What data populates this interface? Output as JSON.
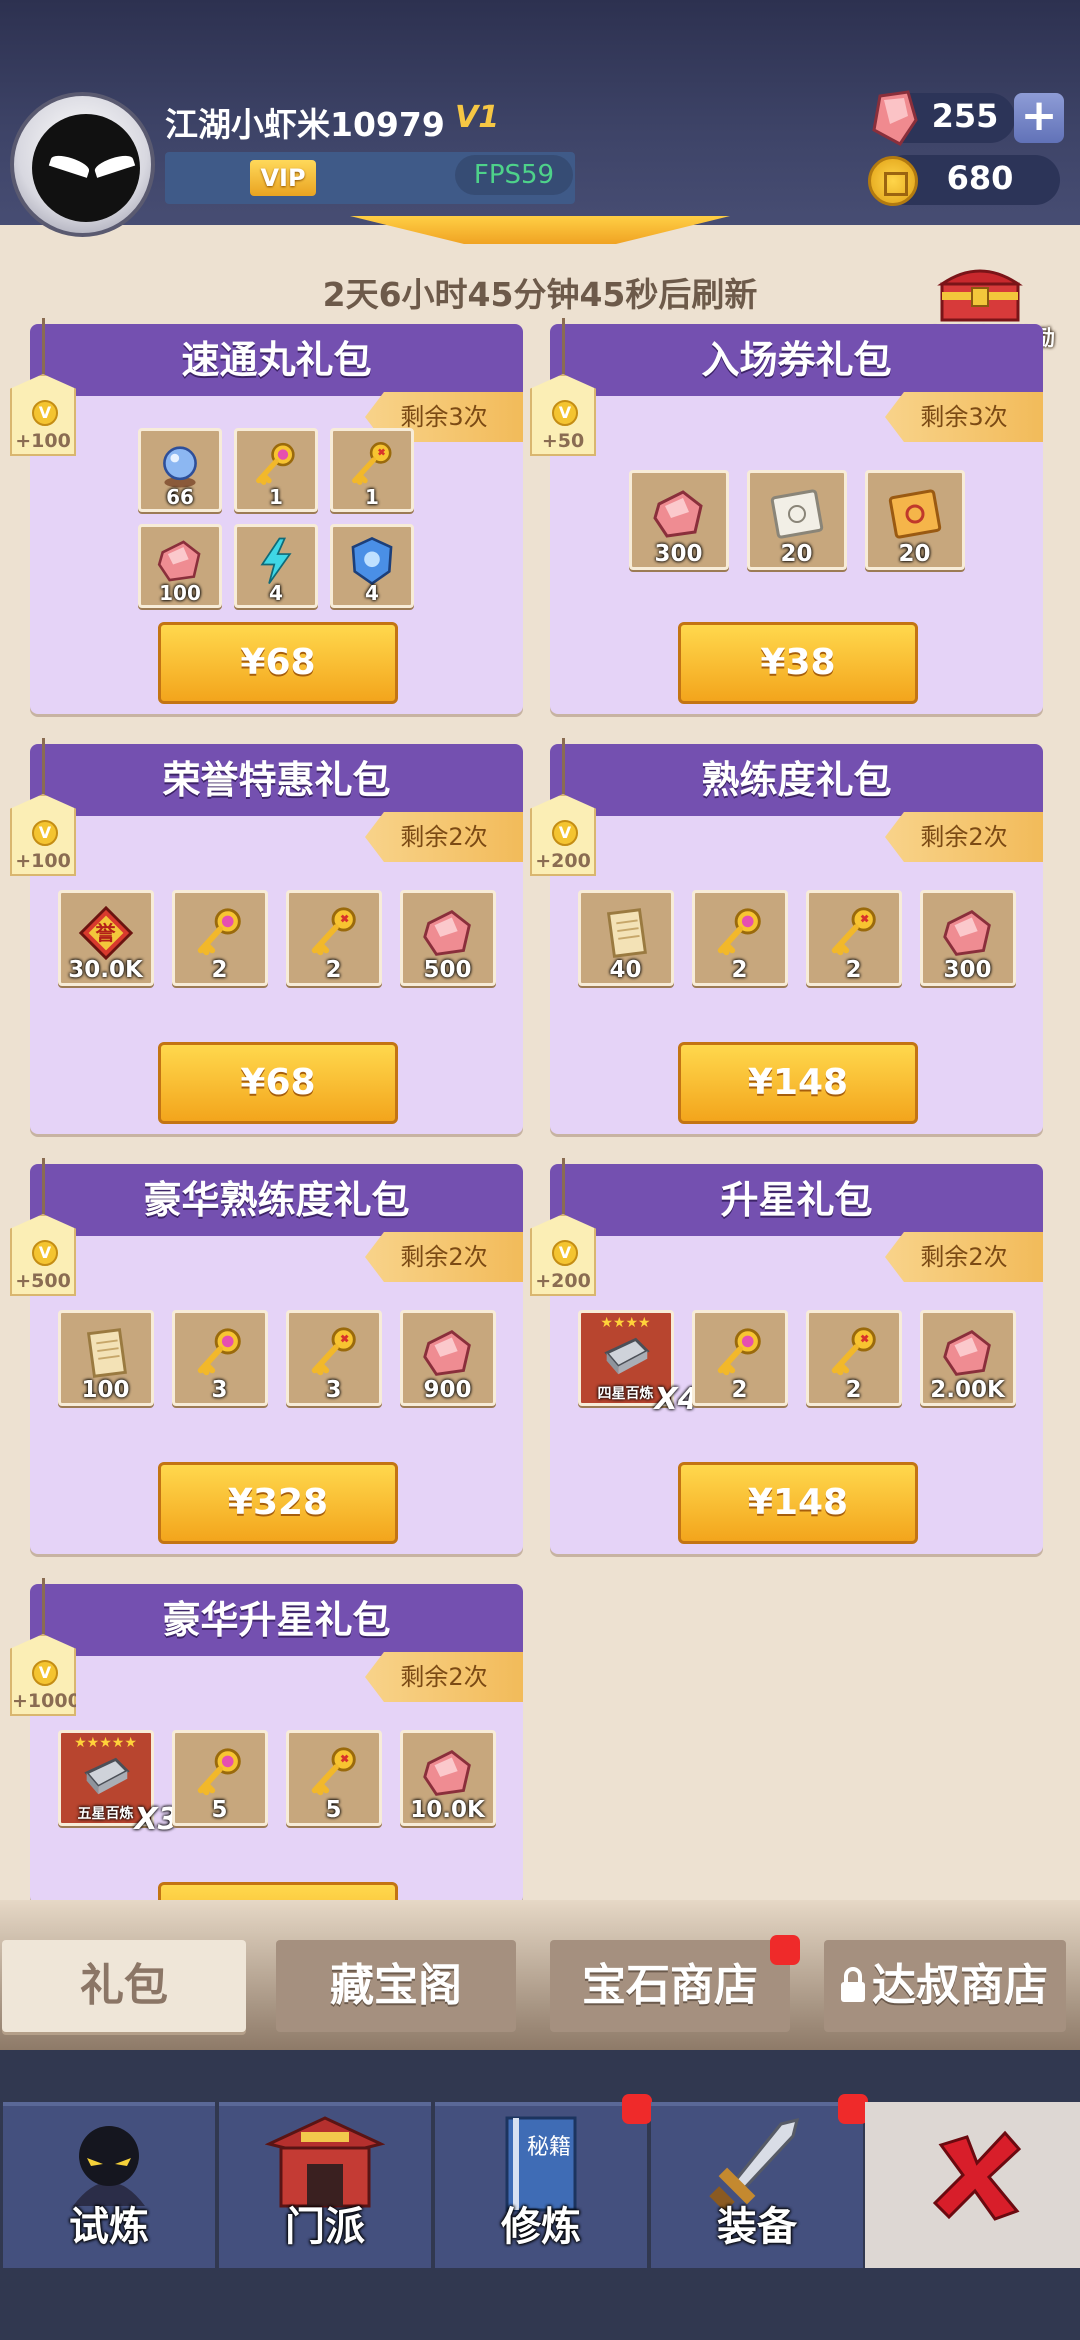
{
  "header": {
    "player_name": "江湖小虾米10979",
    "vip_level": "V1",
    "vip_label": "VIP",
    "fps": "FPS59",
    "gems": "255",
    "coins": "680",
    "add_label": "+"
  },
  "refresh_timer": "2天6小时45分钟45秒后刷新",
  "first_purchase_label": "首次购买奖励",
  "packs": [
    {
      "title": "速通丸礼包",
      "remaining": "剩余3次",
      "vip_points": "+100",
      "price": "¥68",
      "items": [
        {
          "icon": "crystal-ball-icon",
          "count": "66"
        },
        {
          "icon": "pink-key-icon",
          "count": "1"
        },
        {
          "icon": "gold-key-icon",
          "count": "1"
        },
        {
          "icon": "gem-icon",
          "count": "100"
        },
        {
          "icon": "lightning-icon",
          "count": "4"
        },
        {
          "icon": "blue-shield-icon",
          "count": "4"
        }
      ]
    },
    {
      "title": "入场券礼包",
      "remaining": "剩余3次",
      "vip_points": "+50",
      "price": "¥38",
      "items": [
        {
          "icon": "gem-icon",
          "count": "300"
        },
        {
          "icon": "white-ticket-icon",
          "count": "20"
        },
        {
          "icon": "orange-ticket-icon",
          "count": "20"
        }
      ]
    },
    {
      "title": "荣誉特惠礼包",
      "remaining": "剩余2次",
      "vip_points": "+100",
      "price": "¥68",
      "items": [
        {
          "icon": "honor-badge-icon",
          "count": "30.0K",
          "badge_text": "誉"
        },
        {
          "icon": "pink-key-icon",
          "count": "2"
        },
        {
          "icon": "gold-key-icon",
          "count": "2"
        },
        {
          "icon": "gem-icon",
          "count": "500"
        }
      ]
    },
    {
      "title": "熟练度礼包",
      "remaining": "剩余2次",
      "vip_points": "+200",
      "price": "¥148",
      "items": [
        {
          "icon": "scroll-icon",
          "count": "40"
        },
        {
          "icon": "pink-key-icon",
          "count": "2"
        },
        {
          "icon": "gold-key-icon",
          "count": "2"
        },
        {
          "icon": "gem-icon",
          "count": "300"
        }
      ]
    },
    {
      "title": "豪华熟练度礼包",
      "remaining": "剩余2次",
      "vip_points": "+500",
      "price": "¥328",
      "items": [
        {
          "icon": "scroll-icon",
          "count": "100"
        },
        {
          "icon": "pink-key-icon",
          "count": "3"
        },
        {
          "icon": "gold-key-icon",
          "count": "3"
        },
        {
          "icon": "gem-icon",
          "count": "900"
        }
      ]
    },
    {
      "title": "升星礼包",
      "remaining": "剩余2次",
      "vip_points": "+200",
      "price": "¥148",
      "items": [
        {
          "icon": "four-star-ingot-icon",
          "count": "",
          "label": "四星百炼",
          "multiplier": "X4",
          "stars": "★★★★"
        },
        {
          "icon": "pink-key-icon",
          "count": "2"
        },
        {
          "icon": "gold-key-icon",
          "count": "2"
        },
        {
          "icon": "gem-icon",
          "count": "2.00K"
        }
      ]
    },
    {
      "title": "豪华升星礼包",
      "remaining": "剩余2次",
      "vip_points": "+1000",
      "price": "",
      "items": [
        {
          "icon": "five-star-ingot-icon",
          "count": "",
          "label": "五星百炼",
          "multiplier": "X3",
          "stars": "★★★★★"
        },
        {
          "icon": "pink-key-icon",
          "count": "5"
        },
        {
          "icon": "gold-key-icon",
          "count": "5"
        },
        {
          "icon": "gem-icon",
          "count": "10.0K"
        }
      ]
    }
  ],
  "shop_tabs": [
    {
      "label": "礼包",
      "active": true,
      "badge": false
    },
    {
      "label": "藏宝阁",
      "active": false,
      "badge": false
    },
    {
      "label": "宝石商店",
      "active": false,
      "badge": true
    },
    {
      "label": "达叔商店",
      "active": false,
      "badge": false,
      "locked": true
    }
  ],
  "bottom_nav": [
    {
      "label": "试炼",
      "icon": "ninja-icon",
      "badge": false
    },
    {
      "label": "门派",
      "icon": "temple-icon",
      "badge": false
    },
    {
      "label": "修炼",
      "icon": "manual-icon",
      "badge": true,
      "book_text": "秘籍"
    },
    {
      "label": "装备",
      "icon": "sword-icon",
      "badge": true
    }
  ],
  "colors": {
    "accent": "#7450b0",
    "button": "#f3a51c",
    "panel": "#e5d3f7",
    "header": "#3e4468"
  }
}
